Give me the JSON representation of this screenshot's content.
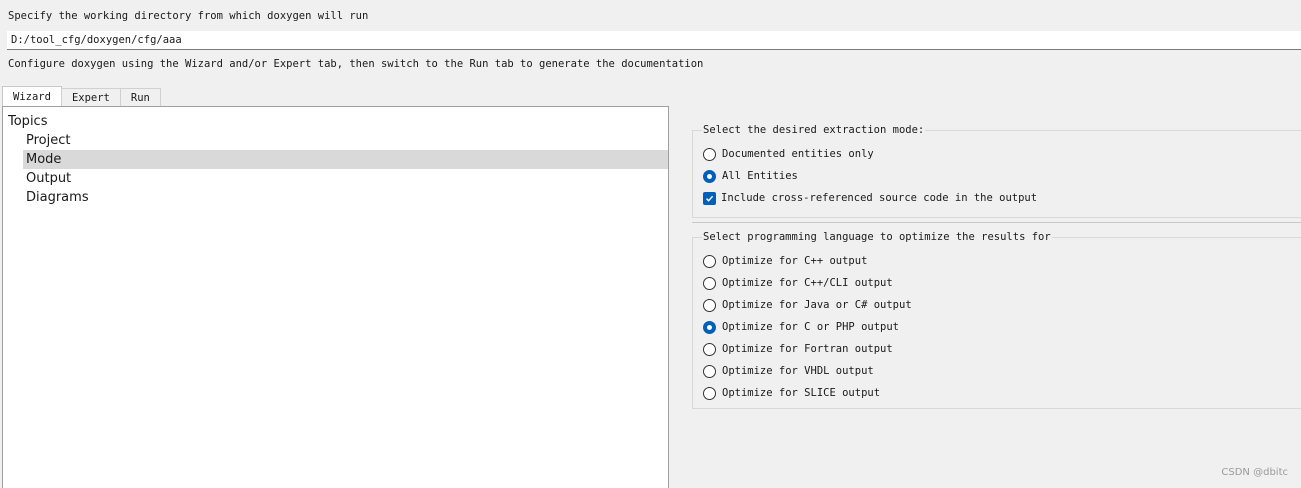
{
  "workdir": {
    "label": "Specify the working directory from which doxygen will run",
    "value": "D:/tool_cfg/doxygen/cfg/aaa"
  },
  "configure_label": "Configure doxygen using the Wizard and/or Expert tab, then switch to the Run tab to generate the documentation",
  "tabs": [
    {
      "label": "Wizard",
      "active": true
    },
    {
      "label": "Expert",
      "active": false
    },
    {
      "label": "Run",
      "active": false
    }
  ],
  "topics": {
    "root": "Topics",
    "items": [
      "Project",
      "Mode",
      "Output",
      "Diagrams"
    ],
    "selected": "Mode"
  },
  "extraction": {
    "title": "Select the desired extraction mode:",
    "options": [
      {
        "label": "Documented entities only",
        "checked": false
      },
      {
        "label": "All Entities",
        "checked": true
      }
    ],
    "cross_ref": {
      "label": "Include cross-referenced source code in the output",
      "checked": true
    }
  },
  "language": {
    "title": "Select programming language to optimize the results for",
    "options": [
      {
        "label": "Optimize for C++ output",
        "checked": false
      },
      {
        "label": "Optimize for C++/CLI output",
        "checked": false
      },
      {
        "label": "Optimize for Java or C# output",
        "checked": false
      },
      {
        "label": "Optimize for C or PHP output",
        "checked": true
      },
      {
        "label": "Optimize for Fortran output",
        "checked": false
      },
      {
        "label": "Optimize for VHDL output",
        "checked": false
      },
      {
        "label": "Optimize for SLICE output",
        "checked": false
      }
    ]
  },
  "watermark": "CSDN @dbitc",
  "colors": {
    "accent": "#005fb8",
    "selection": "#d9d9d9"
  }
}
